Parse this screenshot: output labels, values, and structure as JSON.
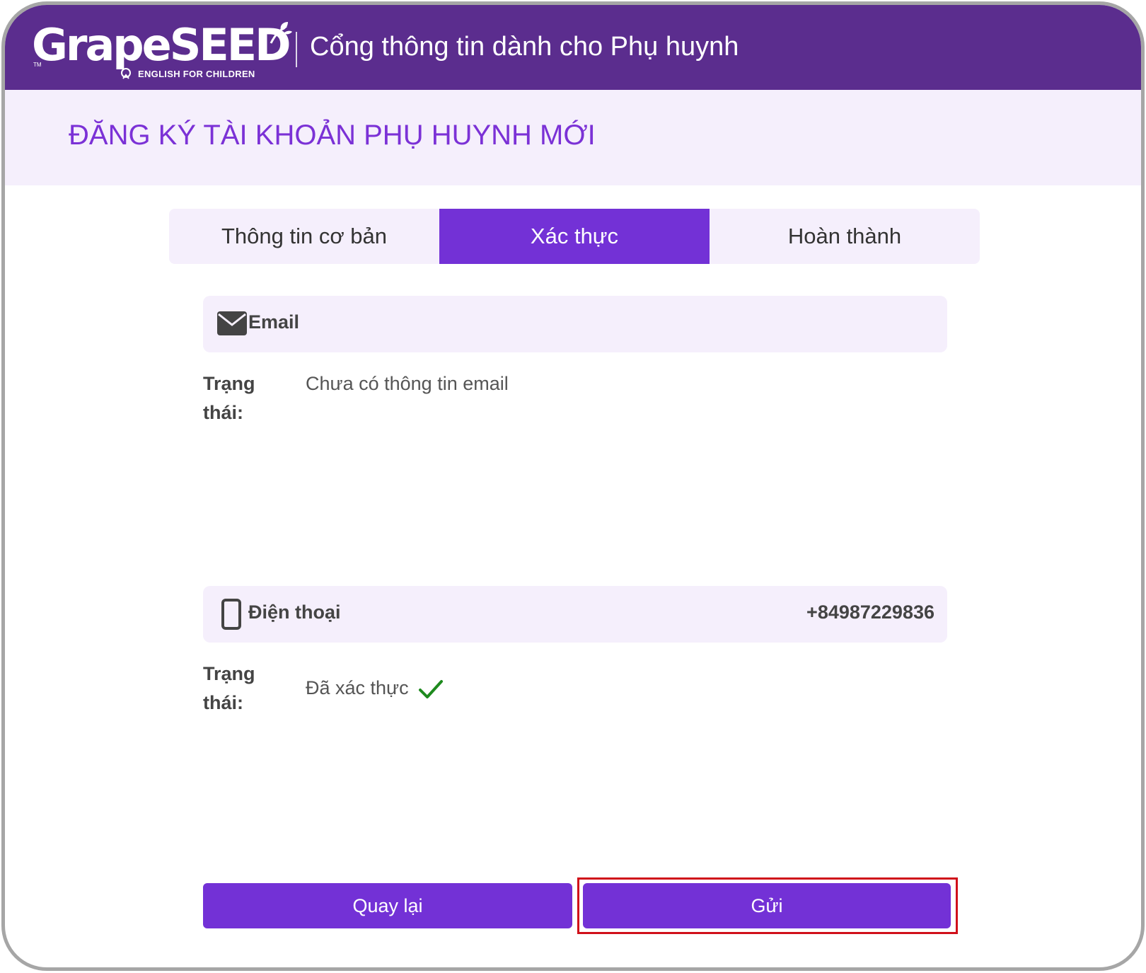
{
  "header": {
    "logo_text": "GrapeSEED",
    "logo_subtitle": "ENGLISH FOR CHILDREN",
    "logo_tm": "TM",
    "portal_title": "Cổng thông tin dành cho Phụ huynh"
  },
  "page": {
    "title": "ĐĂNG KÝ TÀI KHOẢN PHỤ HUYNH MỚI"
  },
  "tabs": [
    {
      "label": "Thông tin cơ bản",
      "active": false
    },
    {
      "label": "Xác thực",
      "active": true
    },
    {
      "label": "Hoàn thành",
      "active": false
    }
  ],
  "email_section": {
    "icon": "envelope-icon",
    "label": "Email",
    "status_label": "Trạng thái:",
    "status_text": "Chưa có thông tin email"
  },
  "phone_section": {
    "icon": "phone-icon",
    "label": "Điện thoại",
    "value": "+84987229836",
    "status_label": "Trạng thái:",
    "status_text": "Đã xác thực",
    "status_icon": "checkmark-icon"
  },
  "buttons": {
    "back_label": "Quay lại",
    "send_label": "Gửi"
  },
  "colors": {
    "header_bg": "#5b2d8e",
    "accent": "#7331d6",
    "panel_bg": "#f5effc",
    "success": "#1e8a1e",
    "highlight": "#d0101a"
  }
}
